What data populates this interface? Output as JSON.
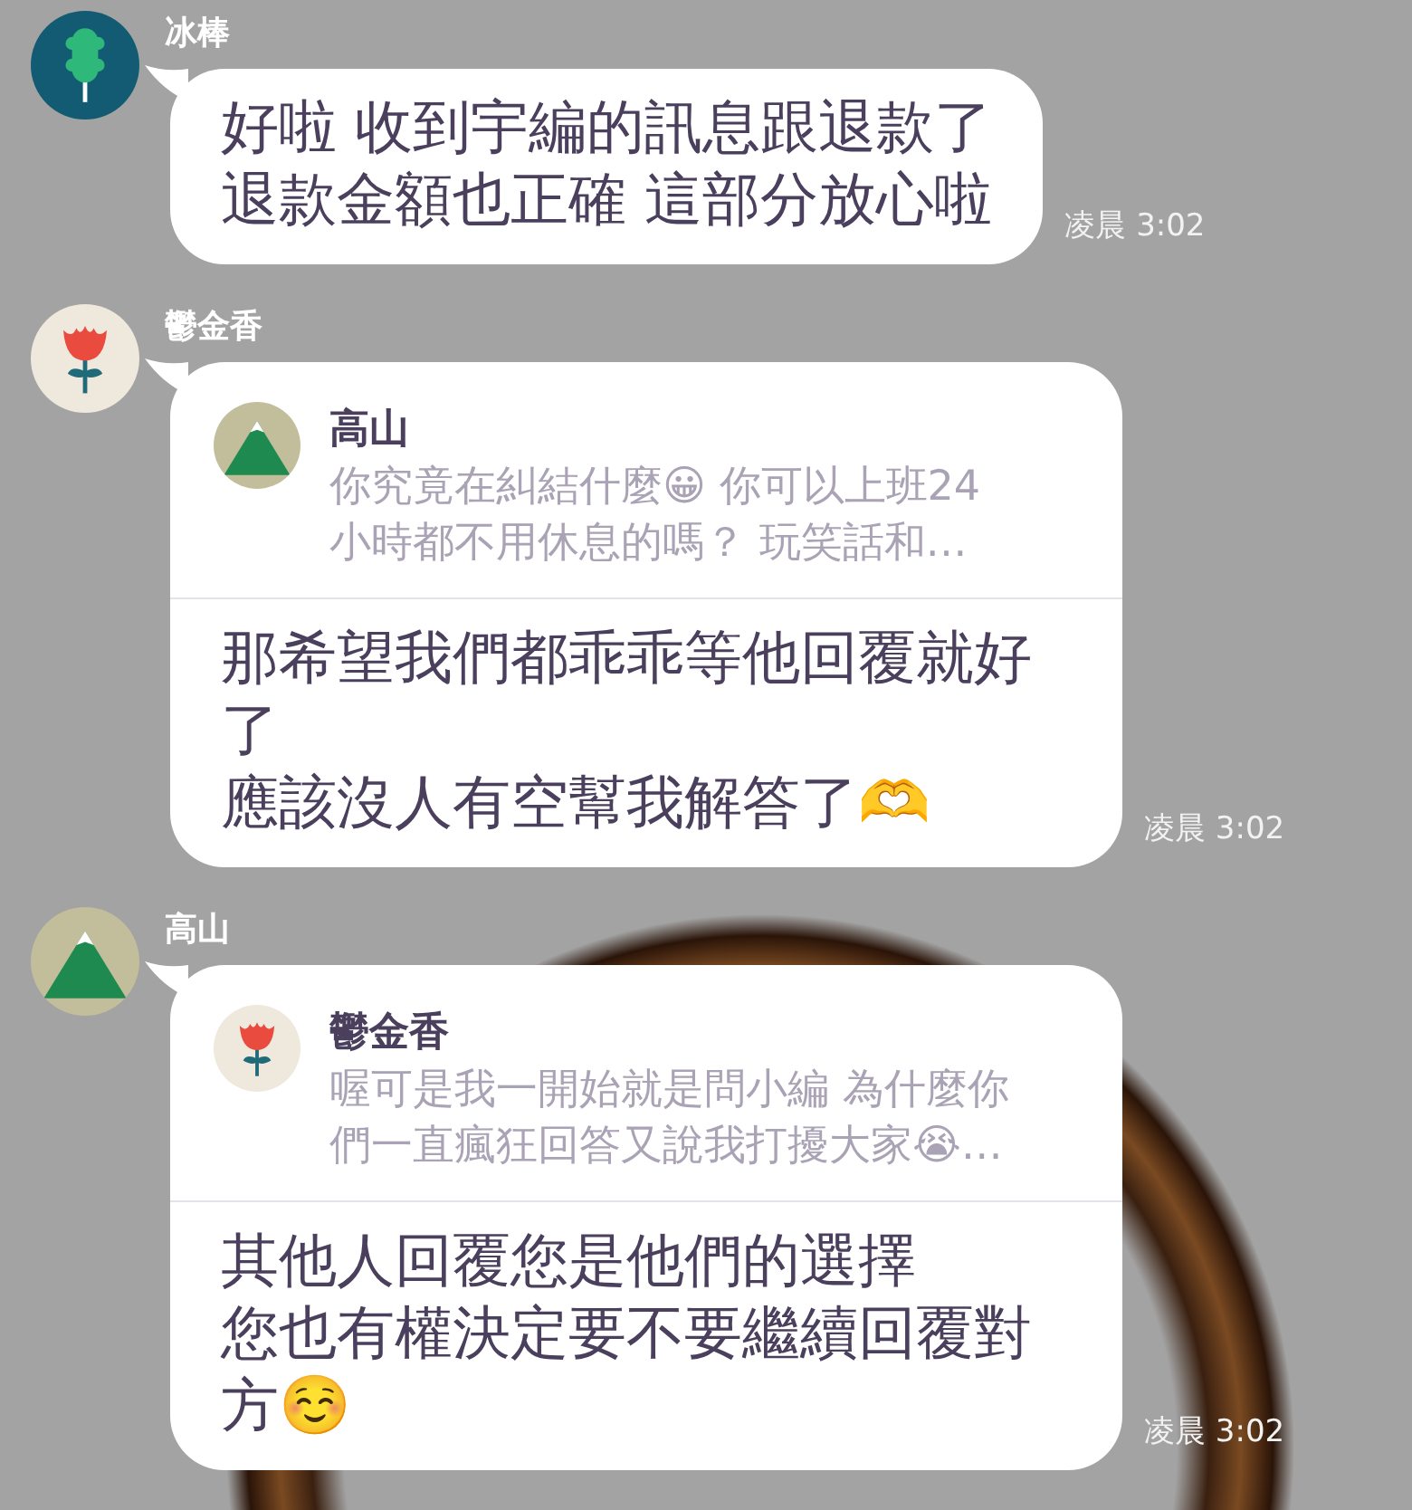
{
  "messages": [
    {
      "sender": "冰棒",
      "avatar": {
        "kind": "popsicle"
      },
      "lines": [
        "好啦 收到宇編的訊息跟退款了",
        "退款金額也正確 這部分放心啦"
      ],
      "time": "凌晨 3:02"
    },
    {
      "sender": "鬱金香",
      "avatar": {
        "kind": "tulip"
      },
      "reply_to": {
        "sender": "高山",
        "avatar": {
          "kind": "mountain"
        },
        "text": "你究竟在糾結什麼😀 你可以上班24小時都不用休息的嗎？ 玩笑話和…"
      },
      "lines": [
        "那希望我們都乖乖等他回覆就好了",
        "應該沒人有空幫我解答了🫶"
      ],
      "time": "凌晨 3:02"
    },
    {
      "sender": "高山",
      "avatar": {
        "kind": "mountain"
      },
      "reply_to": {
        "sender": "鬱金香",
        "avatar": {
          "kind": "tulip"
        },
        "text": "喔可是我一開始就是問小編 為什麼你們一直瘋狂回答又說我打擾大家😭…"
      },
      "lines": [
        "其他人回覆您是他們的選擇",
        "您也有權決定要不要繼續回覆對方☺️"
      ],
      "time": "凌晨 3:02"
    }
  ]
}
